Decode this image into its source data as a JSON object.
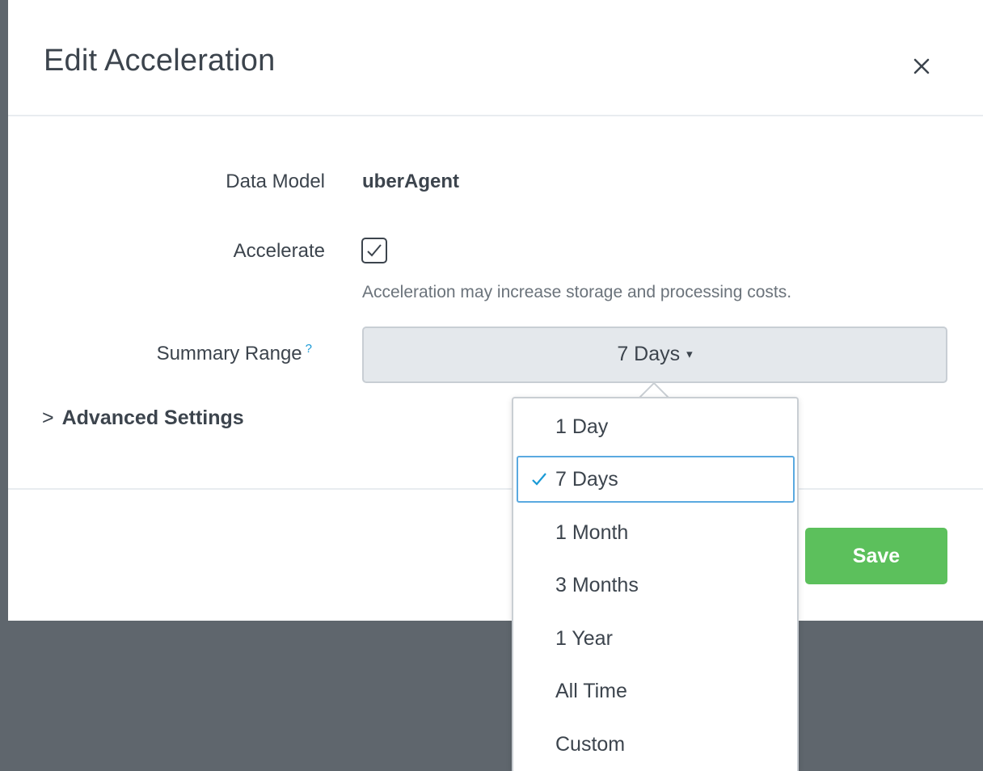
{
  "dialog": {
    "title": "Edit Acceleration",
    "close_icon": "close-icon"
  },
  "form": {
    "data_model_label": "Data Model",
    "data_model_value": "uberAgent",
    "accelerate_label": "Accelerate",
    "accelerate_checked": true,
    "accelerate_help": "Acceleration may increase storage and processing costs.",
    "summary_range_label": "Summary Range",
    "summary_range_help": "?",
    "summary_range_value": "7 Days",
    "summary_range_caret": "▾",
    "advanced_chevron": ">",
    "advanced_label": "Advanced Settings"
  },
  "footer": {
    "save_label": "Save"
  },
  "dropdown": {
    "selected": "7 Days",
    "options": [
      {
        "label": "1 Day"
      },
      {
        "label": "7 Days"
      },
      {
        "label": "1 Month"
      },
      {
        "label": "3 Months"
      },
      {
        "label": "1 Year"
      },
      {
        "label": "All Time"
      },
      {
        "label": "Custom"
      }
    ]
  },
  "colors": {
    "accent_blue": "#1a9ad6",
    "save_green": "#5cc05c",
    "backdrop": "#5f666d"
  }
}
